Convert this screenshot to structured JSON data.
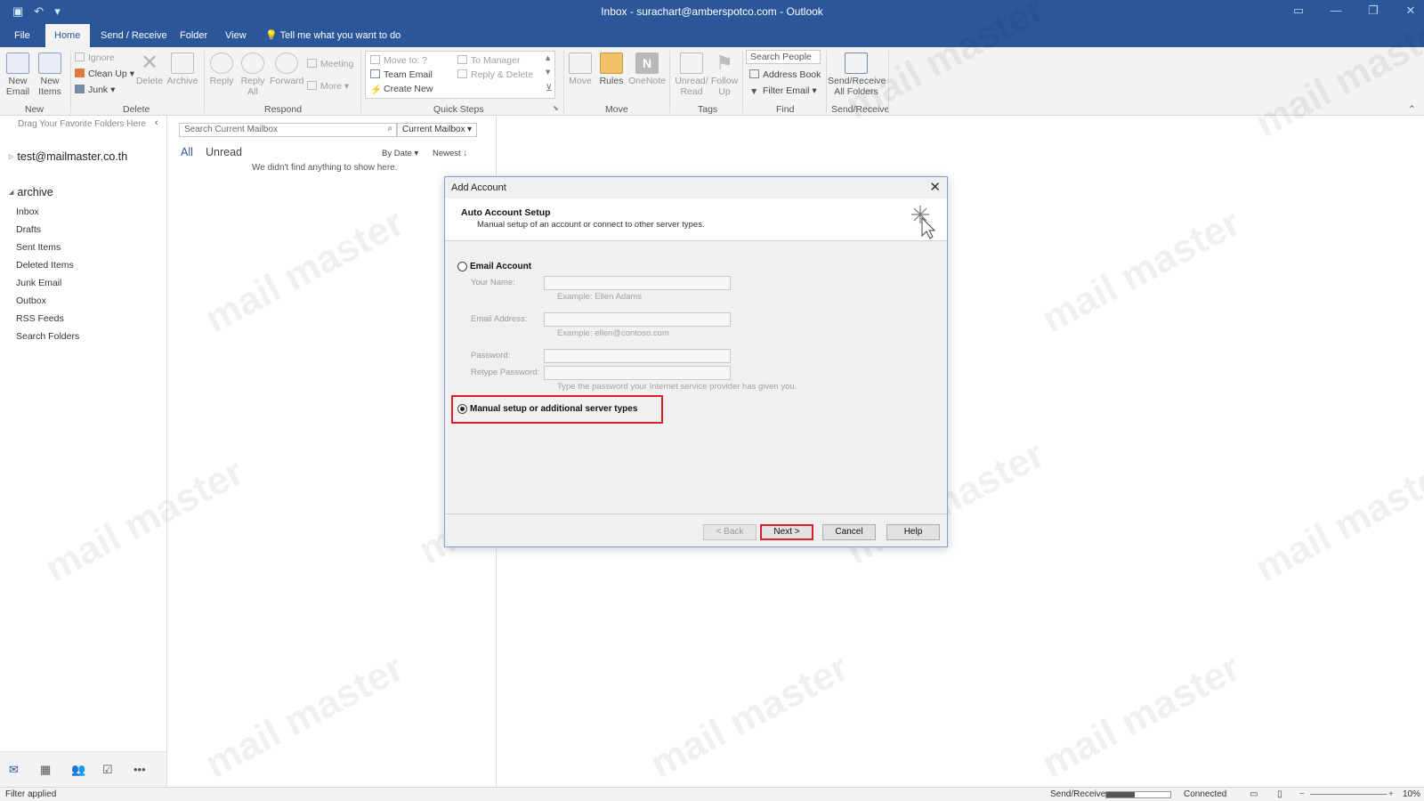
{
  "title_bar": {
    "title": "Inbox - surachart@amberspotco.com  -  Outlook",
    "quick_access": [
      "save-icon",
      "undo-icon",
      "customize-icon"
    ]
  },
  "tabs": [
    "File",
    "Home",
    "Send / Receive",
    "Folder",
    "View",
    "Tell me what you want to do"
  ],
  "active_tab": "Home",
  "ribbon": {
    "new": {
      "new_email": "New Email",
      "new_items": "New Items",
      "group": "New"
    },
    "delete": {
      "ignore": "Ignore",
      "clean_up": "Clean Up",
      "junk": "Junk",
      "delete": "Delete",
      "archive": "Archive",
      "group": "Delete"
    },
    "respond": {
      "reply": "Reply",
      "reply_all": "Reply All",
      "forward": "Forward",
      "meeting": "Meeting",
      "more": "More",
      "group": "Respond"
    },
    "quick_steps": {
      "move_to": "Move to: ?",
      "team_email": "Team Email",
      "create_new": "Create New",
      "to_manager": "To Manager",
      "reply_delete": "Reply & Delete",
      "group": "Quick Steps"
    },
    "move": {
      "move": "Move",
      "rules": "Rules",
      "onenote": "OneNote",
      "group": "Move"
    },
    "tags": {
      "unread_read": "Unread/ Read",
      "follow_up": "Follow Up",
      "group": "Tags"
    },
    "find": {
      "search_people": "Search People",
      "address_book": "Address Book",
      "filter_email": "Filter Email",
      "group": "Find"
    },
    "send_receive": {
      "all_folders": "Send/Receive All Folders",
      "group": "Send/Receive"
    }
  },
  "folder_pane": {
    "favorites_hint": "Drag Your Favorite Folders Here",
    "account1": "test@mailmaster.co.th",
    "account2": "archive",
    "folders": [
      "Inbox",
      "Drafts",
      "Sent Items",
      "Deleted Items",
      "Junk Email",
      "Outbox",
      "RSS Feeds",
      "Search Folders"
    ]
  },
  "message_list": {
    "search_placeholder": "Search Current Mailbox",
    "scope": "Current Mailbox",
    "filter_all": "All",
    "filter_unread": "Unread",
    "sort_by": "By Date",
    "sort_order": "Newest",
    "empty_text": "We didn't find anything to show here."
  },
  "dialog": {
    "title": "Add Account",
    "header_title": "Auto Account Setup",
    "header_subtitle": "Manual setup of an account or connect to other server types.",
    "option_email": "Email Account",
    "your_name_label": "Your Name:",
    "your_name_hint": "Example: Ellen Adams",
    "email_label": "Email Address:",
    "email_hint": "Example: ellen@contoso.com",
    "password_label": "Password:",
    "retype_label": "Retype Password:",
    "password_hint": "Type the password your Internet service provider has given you.",
    "option_manual": "Manual setup or additional server types",
    "selected_option": "manual",
    "btn_back": "< Back",
    "btn_next": "Next >",
    "btn_cancel": "Cancel",
    "btn_help": "Help"
  },
  "status_bar": {
    "left": "Filter applied",
    "send_receive": "Send/Receive",
    "connection": "Connected",
    "zoom": "10%"
  },
  "watermark": "mail master",
  "colors": {
    "accent": "#2b579a",
    "highlight": "#d81f2b"
  }
}
